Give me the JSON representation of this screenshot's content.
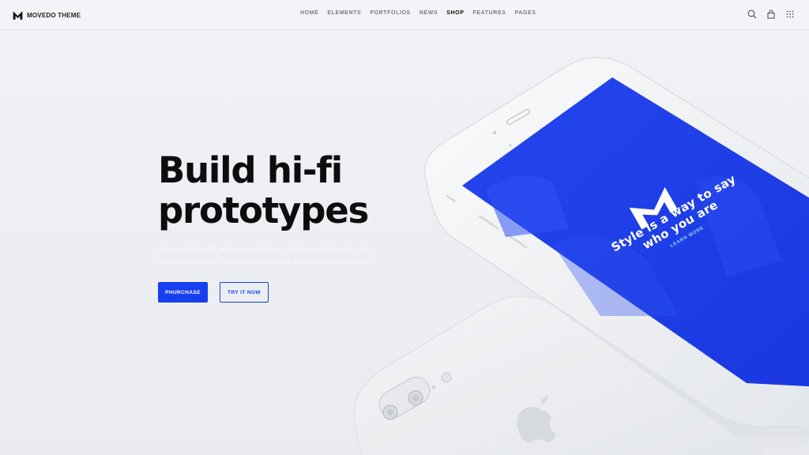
{
  "brand": {
    "name": "MOVEDO THEME",
    "logo_icon": "m-logo-icon"
  },
  "nav": {
    "items": [
      {
        "label": "HOME",
        "active": false
      },
      {
        "label": "ELEMENTS",
        "active": false
      },
      {
        "label": "PORTFOLIOS",
        "active": false
      },
      {
        "label": "NEWS",
        "active": false
      },
      {
        "label": "SHOP",
        "active": true
      },
      {
        "label": "FEATURES",
        "active": false
      },
      {
        "label": "PAGES",
        "active": false
      }
    ]
  },
  "header_icons": [
    "search-icon",
    "bag-icon",
    "grid-menu-icon"
  ],
  "hero": {
    "title_line1": "Build hi-fi",
    "title_line2": "prototypes",
    "description": "ollit nostro blandit sed re, eu ommium regione apeirian sed, duo detracto detraxit in. Te nec unum aliquid, quo et dolor incorrupte",
    "primary_button": "PHURCHASE",
    "secondary_button": "TRY IT NOW"
  },
  "phone_screen": {
    "tagline_line1": "Style is a way to say",
    "tagline_line2": "who you are",
    "link": "LEARN MORE",
    "logo_icon": "m-logo-icon"
  },
  "colors": {
    "accent": "#1640ee",
    "screen_blue": "#1f3fe8",
    "background": "#eef0f3",
    "text_dark": "#0d0d10"
  }
}
